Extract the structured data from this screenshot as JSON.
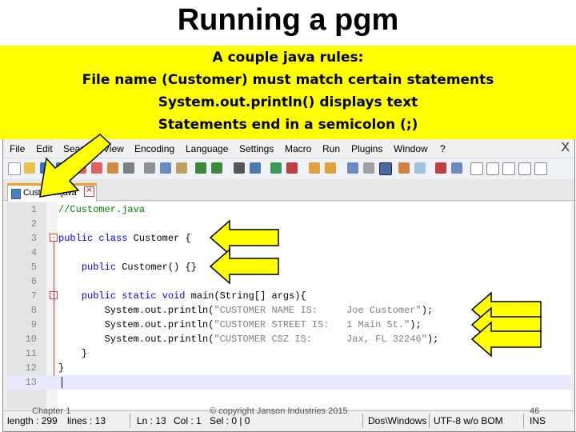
{
  "slide": {
    "title": "Running a pgm",
    "callout_lines": [
      "A couple java rules:",
      "File name (Customer) must match certain statements",
      "System.out.println() displays text",
      "Statements end in a semicolon (;)"
    ],
    "callout_color": "#ffff00",
    "arrow_color": "#ffff00",
    "footer_left": "Chapter 1",
    "footer_center": "© copyright Janson Industries 2015",
    "footer_right": "46"
  },
  "menubar": {
    "items": [
      "File",
      "Edit",
      "Search",
      "View",
      "Encoding",
      "Language",
      "Settings",
      "Macro",
      "Run",
      "Plugins",
      "Window",
      "?"
    ],
    "close_label": "X"
  },
  "tab": {
    "label": "Customer.java",
    "close_label": "✕"
  },
  "editor": {
    "lines": [
      {
        "n": "1",
        "text": "//Customer.java"
      },
      {
        "n": "2",
        "text": ""
      },
      {
        "n": "3",
        "text": "public class Customer {"
      },
      {
        "n": "4",
        "text": ""
      },
      {
        "n": "5",
        "text": "    public Customer() {}"
      },
      {
        "n": "6",
        "text": ""
      },
      {
        "n": "7",
        "text": "    public static void main(String[] args){"
      },
      {
        "n": "8",
        "text": "        System.out.println(\"CUSTOMER NAME IS:     Joe Customer\");"
      },
      {
        "n": "9",
        "text": "        System.out.println(\"CUSTOMER STREET IS:   1 Main St.\");"
      },
      {
        "n": "10",
        "text": "        System.out.println(\"CUSTOMER CSZ IS:      Jax, FL 32246\");"
      },
      {
        "n": "11",
        "text": "    }"
      },
      {
        "n": "12",
        "text": "}"
      },
      {
        "n": "13",
        "text": ""
      }
    ]
  },
  "statusbar": {
    "length": "length : 299",
    "lines": "lines : 13",
    "ln": "Ln : 13",
    "col": "Col : 1",
    "sel": "Sel : 0 | 0",
    "eol": "Dos\\Windows",
    "encoding": "UTF-8 w/o BOM",
    "mode": "INS"
  }
}
